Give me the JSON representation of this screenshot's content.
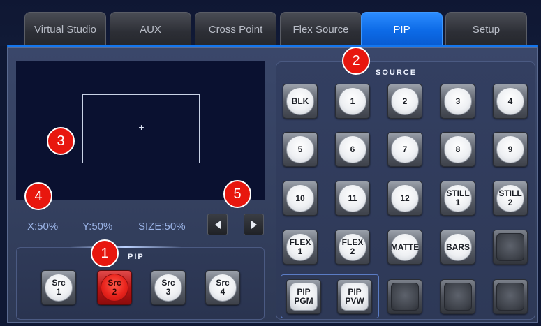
{
  "tabs": [
    {
      "label": "Virtual Studio",
      "active": false
    },
    {
      "label": "AUX",
      "active": false
    },
    {
      "label": "Cross Point",
      "active": false
    },
    {
      "label": "Flex Source",
      "active": false
    },
    {
      "label": "PIP",
      "active": true
    },
    {
      "label": "Setup",
      "active": false
    }
  ],
  "preview": {
    "readout": {
      "x": "X:50%",
      "y": "Y:50%",
      "size": "SIZE:50%"
    }
  },
  "pip_panel": {
    "title": "PIP",
    "buttons": [
      {
        "label": "Src\n1",
        "state": "off"
      },
      {
        "label": "Src\n2",
        "state": "on"
      },
      {
        "label": "Src\n3",
        "state": "off"
      },
      {
        "label": "Src\n4",
        "state": "off"
      }
    ]
  },
  "source_panel": {
    "title": "SOURCE",
    "rows": [
      [
        "BLK",
        "1",
        "2",
        "3",
        "4"
      ],
      [
        "5",
        "6",
        "7",
        "8",
        "9"
      ],
      [
        "10",
        "11",
        "12",
        "STILL\n1",
        "STILL\n2"
      ],
      [
        "FLEX\n1",
        "FLEX\n2",
        "MATTE",
        "BARS",
        ""
      ],
      [
        "PIP\nPGM",
        "PIP\nPVW",
        "",
        "",
        ""
      ]
    ]
  },
  "markers": [
    "1",
    "2",
    "3",
    "4",
    "5"
  ],
  "colors": {
    "accent": "#0c6ae6",
    "active_key": "#e8231c",
    "marker": "#e8170e",
    "background": "#0f1834"
  },
  "icons": {
    "left": "caret-left-icon",
    "right": "caret-right-icon",
    "crosshair": "crosshair-icon"
  }
}
